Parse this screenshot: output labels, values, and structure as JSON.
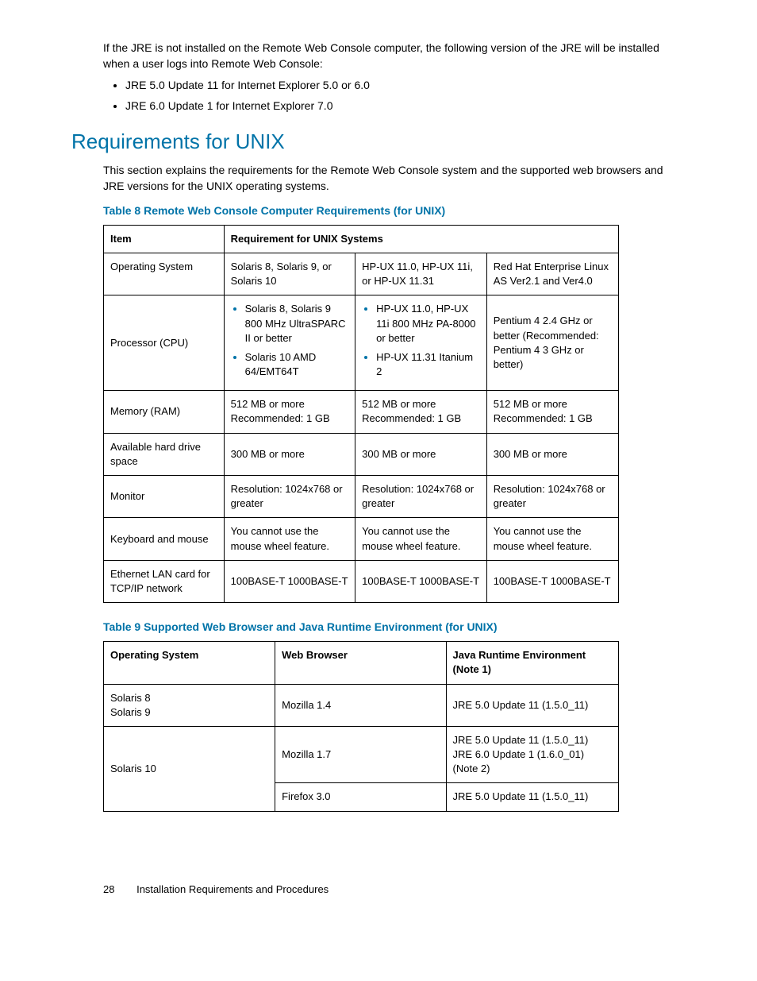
{
  "intro": {
    "text": "If the JRE is not installed on the Remote Web Console computer, the following version of the JRE will be installed when a user logs into Remote Web Console:",
    "bullets": [
      "JRE 5.0 Update 11 for Internet Explorer 5.0 or 6.0",
      "JRE 6.0 Update 1 for Internet Explorer 7.0"
    ]
  },
  "section": {
    "heading": "Requirements for UNIX",
    "text": "This section explains the requirements for the Remote Web Console system and the supported web browsers and JRE versions for the UNIX operating systems."
  },
  "table8": {
    "caption": "Table 8 Remote Web Console Computer Requirements (for UNIX)",
    "head": {
      "item": "Item",
      "req": "Requirement for UNIX Systems"
    },
    "rows": {
      "os": {
        "label": "Operating System",
        "c1": "Solaris 8, Solaris 9, or Solaris 10",
        "c2": "HP-UX 11.0, HP-UX 11i, or HP-UX 11.31",
        "c3": "Red Hat Enterprise Linux AS Ver2.1 and Ver4.0"
      },
      "cpu": {
        "label": "Processor (CPU)",
        "c1_b1": "Solaris 8, Solaris 9 800 MHz UltraSPARC II or better",
        "c1_b2": "Solaris 10 AMD 64/EMT64T",
        "c2_b1": "HP-UX 11.0, HP-UX 11i 800 MHz PA-8000 or better",
        "c2_b2": "HP-UX 11.31 Itanium 2",
        "c3": "Pentium 4 2.4 GHz or better (Recommended: Pentium 4 3 GHz or better)"
      },
      "ram": {
        "label": "Memory (RAM)",
        "c1a": "512 MB or more",
        "c1b": "Recommended: 1 GB",
        "c2a": "512 MB or more",
        "c2b": "Recommended: 1 GB",
        "c3a": "512 MB or more",
        "c3b": "Recommended: 1 GB"
      },
      "hdd": {
        "label": "Available hard drive space",
        "c1": "300 MB or more",
        "c2": "300 MB or more",
        "c3": "300 MB or more"
      },
      "monitor": {
        "label": "Monitor",
        "c1": "Resolution: 1024x768 or greater",
        "c2": "Resolution: 1024x768 or greater",
        "c3": "Resolution: 1024x768 or greater"
      },
      "kbm": {
        "label": "Keyboard and mouse",
        "c1": "You cannot use the mouse wheel feature.",
        "c2": "You cannot use the mouse wheel feature.",
        "c3": "You cannot use the mouse wheel feature."
      },
      "lan": {
        "label": "Ethernet LAN card for TCP/IP network",
        "c1": "100BASE-T 1000BASE-T",
        "c2": "100BASE-T 1000BASE-T",
        "c3": "100BASE-T 1000BASE-T"
      }
    }
  },
  "table9": {
    "caption": "Table 9 Supported Web Browser and Java Runtime Environment (for UNIX)",
    "head": {
      "os": "Operating System",
      "wb": "Web Browser",
      "jre": "Java Runtime Environment (Note 1)"
    },
    "rows": {
      "r1": {
        "os_a": "Solaris 8",
        "os_b": "Solaris 9",
        "wb": "Mozilla 1.4",
        "jre": "JRE 5.0 Update 11 (1.5.0_11)"
      },
      "r2": {
        "os": "Solaris 10",
        "wb": "Mozilla 1.7",
        "jre_a": "JRE 5.0 Update 11 (1.5.0_11)",
        "jre_b": "JRE 6.0 Update 1 (1.6.0_01)",
        "jre_c": "(Note 2)"
      },
      "r3": {
        "wb": "Firefox 3.0",
        "jre": "JRE 5.0 Update 11 (1.5.0_11)"
      }
    }
  },
  "footer": {
    "page": "28",
    "title": "Installation Requirements and Procedures"
  },
  "chart_data": [
    {
      "type": "table",
      "title": "Table 8 Remote Web Console Computer Requirements (for UNIX)",
      "columns": [
        "Item",
        "Solaris",
        "HP-UX",
        "Red Hat Enterprise Linux"
      ],
      "rows": [
        [
          "Operating System",
          "Solaris 8, Solaris 9, or Solaris 10",
          "HP-UX 11.0, HP-UX 11i, or HP-UX 11.31",
          "Red Hat Enterprise Linux AS Ver2.1 and Ver4.0"
        ],
        [
          "Processor (CPU)",
          "Solaris 8, Solaris 9 800 MHz UltraSPARC II or better; Solaris 10 AMD 64/EMT64T",
          "HP-UX 11.0, HP-UX 11i 800 MHz PA-8000 or better; HP-UX 11.31 Itanium 2",
          "Pentium 4 2.4 GHz or better (Recommended: Pentium 4 3 GHz or better)"
        ],
        [
          "Memory (RAM)",
          "512 MB or more; Recommended: 1 GB",
          "512 MB or more; Recommended: 1 GB",
          "512 MB or more; Recommended: 1 GB"
        ],
        [
          "Available hard drive space",
          "300 MB or more",
          "300 MB or more",
          "300 MB or more"
        ],
        [
          "Monitor",
          "Resolution: 1024x768 or greater",
          "Resolution: 1024x768 or greater",
          "Resolution: 1024x768 or greater"
        ],
        [
          "Keyboard and mouse",
          "You cannot use the mouse wheel feature.",
          "You cannot use the mouse wheel feature.",
          "You cannot use the mouse wheel feature."
        ],
        [
          "Ethernet LAN card for TCP/IP network",
          "100BASE-T 1000BASE-T",
          "100BASE-T 1000BASE-T",
          "100BASE-T 1000BASE-T"
        ]
      ]
    },
    {
      "type": "table",
      "title": "Table 9 Supported Web Browser and Java Runtime Environment (for UNIX)",
      "columns": [
        "Operating System",
        "Web Browser",
        "Java Runtime Environment (Note 1)"
      ],
      "rows": [
        [
          "Solaris 8 / Solaris 9",
          "Mozilla 1.4",
          "JRE 5.0 Update 11 (1.5.0_11)"
        ],
        [
          "Solaris 10",
          "Mozilla 1.7",
          "JRE 5.0 Update 11 (1.5.0_11); JRE 6.0 Update 1 (1.6.0_01) (Note 2)"
        ],
        [
          "Solaris 10",
          "Firefox 3.0",
          "JRE 5.0 Update 11 (1.5.0_11)"
        ]
      ]
    }
  ]
}
